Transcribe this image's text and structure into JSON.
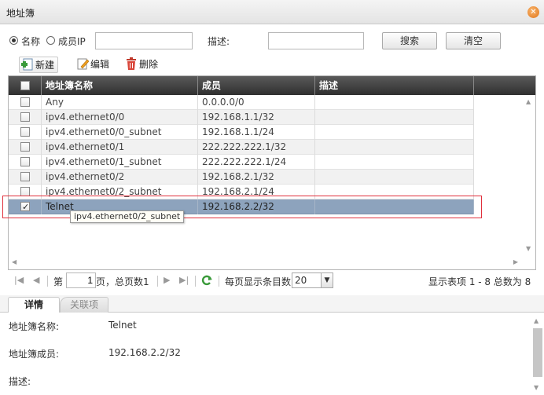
{
  "window": {
    "title": "地址簿",
    "close_icon": "close-icon",
    "accent": "#e0761b"
  },
  "search": {
    "radio_name_label": "名称",
    "radio_member_label": "成员IP",
    "name_value": "",
    "desc_label": "描述:",
    "desc_value": "",
    "search_button": "搜索",
    "clear_button": "清空"
  },
  "toolbar": {
    "new_label": "新建",
    "edit_label": "编辑",
    "delete_label": "删除"
  },
  "table": {
    "columns": [
      "地址簿名称",
      "成员",
      "描述"
    ],
    "rows": [
      {
        "name": "Any",
        "member": "0.0.0.0/0",
        "desc": ""
      },
      {
        "name": "ipv4.ethernet0/0",
        "member": "192.168.1.1/32",
        "desc": ""
      },
      {
        "name": "ipv4.ethernet0/0_subnet",
        "member": "192.168.1.1/24",
        "desc": ""
      },
      {
        "name": "ipv4.ethernet0/1",
        "member": "222.222.222.1/32",
        "desc": ""
      },
      {
        "name": "ipv4.ethernet0/1_subnet",
        "member": "222.222.222.1/24",
        "desc": ""
      },
      {
        "name": "ipv4.ethernet0/2",
        "member": "192.168.2.1/32",
        "desc": ""
      },
      {
        "name": "ipv4.ethernet0/2_subnet",
        "member": "192.168.2.1/24",
        "desc": ""
      },
      {
        "name": "Telnet",
        "member": "192.168.2.2/32",
        "desc": ""
      }
    ],
    "selected_row": 7,
    "tooltip": "ipv4.ethernet0/2_subnet",
    "highlight_color": "#e0303c"
  },
  "pager": {
    "page_prefix": "第",
    "page_value": "1",
    "page_suffix": "页，总页数1",
    "per_page_label": "每页显示条目数",
    "per_page_value": "20",
    "summary": "显示表项 1 - 8 总数为 8"
  },
  "tabs": {
    "details": "详情",
    "related": "关联项"
  },
  "details": {
    "name_label": "地址簿名称:",
    "name_value": "Telnet",
    "member_label": "地址簿成员:",
    "member_value": "192.168.2.2/32",
    "desc_label": "描述:",
    "desc_value": ""
  }
}
